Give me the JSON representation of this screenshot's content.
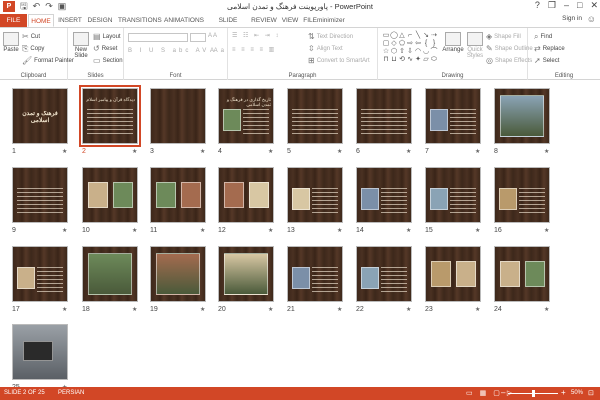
{
  "window": {
    "title": "پاورپوینت فرهنگ و تمدن اسلامی - PowerPoint",
    "app_icon_label": "P",
    "qat_icons": [
      "save-icon",
      "undo-icon",
      "redo-icon",
      "start-from-beginning-icon"
    ],
    "controls": {
      "help": "?",
      "restore": "❐",
      "minimize": "–",
      "maximize": "□",
      "close": "✕"
    }
  },
  "tabs": {
    "file": "FILE",
    "items": [
      {
        "label": "HOME",
        "active": true
      },
      {
        "label": "INSERT"
      },
      {
        "label": "DESIGN"
      },
      {
        "label": "TRANSITIONS"
      },
      {
        "label": "ANIMATIONS"
      },
      {
        "label": "SLIDE SHOW"
      },
      {
        "label": "REVIEW"
      },
      {
        "label": "VIEW"
      },
      {
        "label": "FILEminimizer"
      }
    ],
    "sign_in": "Sign in"
  },
  "ribbon": {
    "clipboard": {
      "label": "Clipboard",
      "paste": "Paste",
      "cut": "Cut",
      "copy": "Copy",
      "format_painter": "Format Painter"
    },
    "slides": {
      "label": "Slides",
      "new_slide": "New Slide",
      "layout": "Layout",
      "reset": "Reset",
      "section": "Section"
    },
    "font": {
      "label": "Font"
    },
    "paragraph": {
      "label": "Paragraph",
      "text_direction": "Text Direction",
      "align_text": "Align Text",
      "convert_smartart": "Convert to SmartArt"
    },
    "drawing": {
      "label": "Drawing",
      "arrange": "Arrange",
      "quick_styles": "Quick Styles",
      "shape_fill": "Shape Fill",
      "shape_outline": "Shape Outline",
      "shape_effects": "Shape Effects"
    },
    "editing": {
      "label": "Editing",
      "find": "Find",
      "replace": "Replace",
      "select": "Select"
    }
  },
  "slides": [
    {
      "num": "1",
      "title": "فرهنگ و تمدن اسلامی",
      "kind": "title"
    },
    {
      "num": "2",
      "title": "دیدگاه قرآن و پیامبر اسلام",
      "kind": "text",
      "selected": true
    },
    {
      "num": "3",
      "title": "",
      "kind": "blank"
    },
    {
      "num": "4",
      "title": "تاریخ گذاری در فرهنگ و تمدن اسلامی",
      "kind": "mixed"
    },
    {
      "num": "5",
      "title": "",
      "kind": "text"
    },
    {
      "num": "6",
      "title": "",
      "kind": "text"
    },
    {
      "num": "7",
      "title": "",
      "kind": "mixed"
    },
    {
      "num": "8",
      "title": "",
      "kind": "photo"
    },
    {
      "num": "9",
      "title": "",
      "kind": "text"
    },
    {
      "num": "10",
      "title": "",
      "kind": "images"
    },
    {
      "num": "11",
      "title": "",
      "kind": "images"
    },
    {
      "num": "12",
      "title": "",
      "kind": "images"
    },
    {
      "num": "13",
      "title": "",
      "kind": "mixed"
    },
    {
      "num": "14",
      "title": "",
      "kind": "mixed"
    },
    {
      "num": "15",
      "title": "",
      "kind": "mixed"
    },
    {
      "num": "16",
      "title": "",
      "kind": "mixed"
    },
    {
      "num": "17",
      "title": "",
      "kind": "mixed"
    },
    {
      "num": "18",
      "title": "",
      "kind": "photo"
    },
    {
      "num": "19",
      "title": "",
      "kind": "photo"
    },
    {
      "num": "20",
      "title": "",
      "kind": "photo"
    },
    {
      "num": "21",
      "title": "",
      "kind": "mixed"
    },
    {
      "num": "22",
      "title": "",
      "kind": "mixed"
    },
    {
      "num": "23",
      "title": "",
      "kind": "images"
    },
    {
      "num": "24",
      "title": "",
      "kind": "images"
    },
    {
      "num": "25",
      "title": "",
      "kind": "photo-laptop"
    }
  ],
  "status": {
    "slide_info": "SLIDE 2 OF 25",
    "language": "PERSIAN",
    "zoom": "50%",
    "zoom_fraction": 0.5
  },
  "colors": {
    "accent": "#d24726",
    "slide_bg": "#3d281b"
  }
}
